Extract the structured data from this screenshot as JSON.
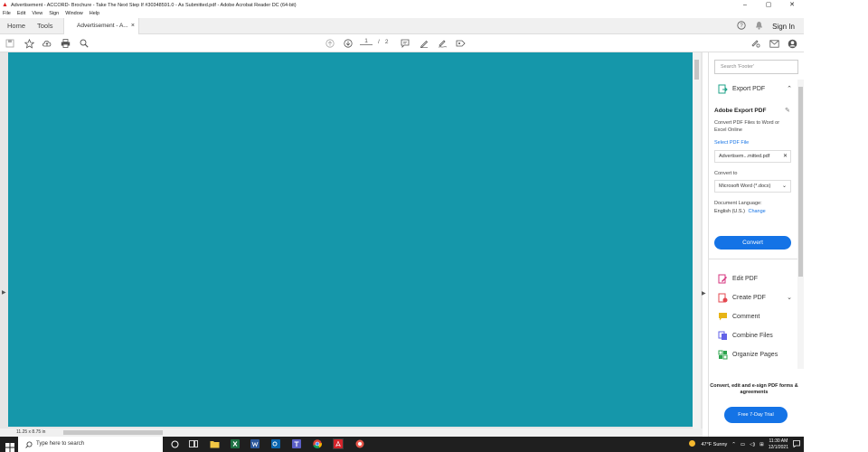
{
  "window": {
    "title": "Advertisement - ACCORD- Brochure - Take The Next Step If #30348591.0 - As Submitted.pdf - Adobe Acrobat Reader DC (64-bit)",
    "controls": [
      "–",
      "▢",
      "✕"
    ]
  },
  "menu": [
    "File",
    "Edit",
    "View",
    "Sign",
    "Window",
    "Help"
  ],
  "tabs": {
    "home": "Home",
    "tools": "Tools",
    "doc": "Advertisement - A...",
    "doc_close": "×"
  },
  "header": {
    "help": "?",
    "signin": "Sign In"
  },
  "toolbar": {
    "page_current": "1",
    "page_sep": "/",
    "page_total": "2"
  },
  "status": {
    "page_size": "11.25 x 8.75 in"
  },
  "panel": {
    "search_placeholder": "Search 'Footer'",
    "export_label": "Export PDF",
    "export_head": "Adobe Export PDF",
    "export_desc": "Convert PDF Files to Word or Excel Online",
    "select_link": "Select PDF File",
    "file_name": "Advertisem...mitted.pdf",
    "convert_to": "Convert to",
    "format": "Microsoft Word (*.docx)",
    "doc_lang": "Document Language:",
    "lang_value": "English (U.S.)",
    "lang_change": "Change",
    "convert_btn": "Convert",
    "tools": [
      {
        "label": "Edit PDF",
        "color": "#d6337e"
      },
      {
        "label": "Create PDF",
        "color": "#e34850"
      },
      {
        "label": "Comment",
        "color": "#e7b416"
      },
      {
        "label": "Combine Files",
        "color": "#6262e8"
      },
      {
        "label": "Organize Pages",
        "color": "#2da44e"
      }
    ],
    "promo": "Convert, edit and e-sign PDF forms & agreements",
    "trial_btn": "Free 7-Day Trial"
  },
  "taskbar": {
    "search_placeholder": "Type here to search",
    "weather": "47°F  Sunny",
    "time": "11:30 AM",
    "date": "12/1/2021"
  },
  "colors": {
    "page_fill": "#1597aa",
    "accent": "#1473e6"
  }
}
